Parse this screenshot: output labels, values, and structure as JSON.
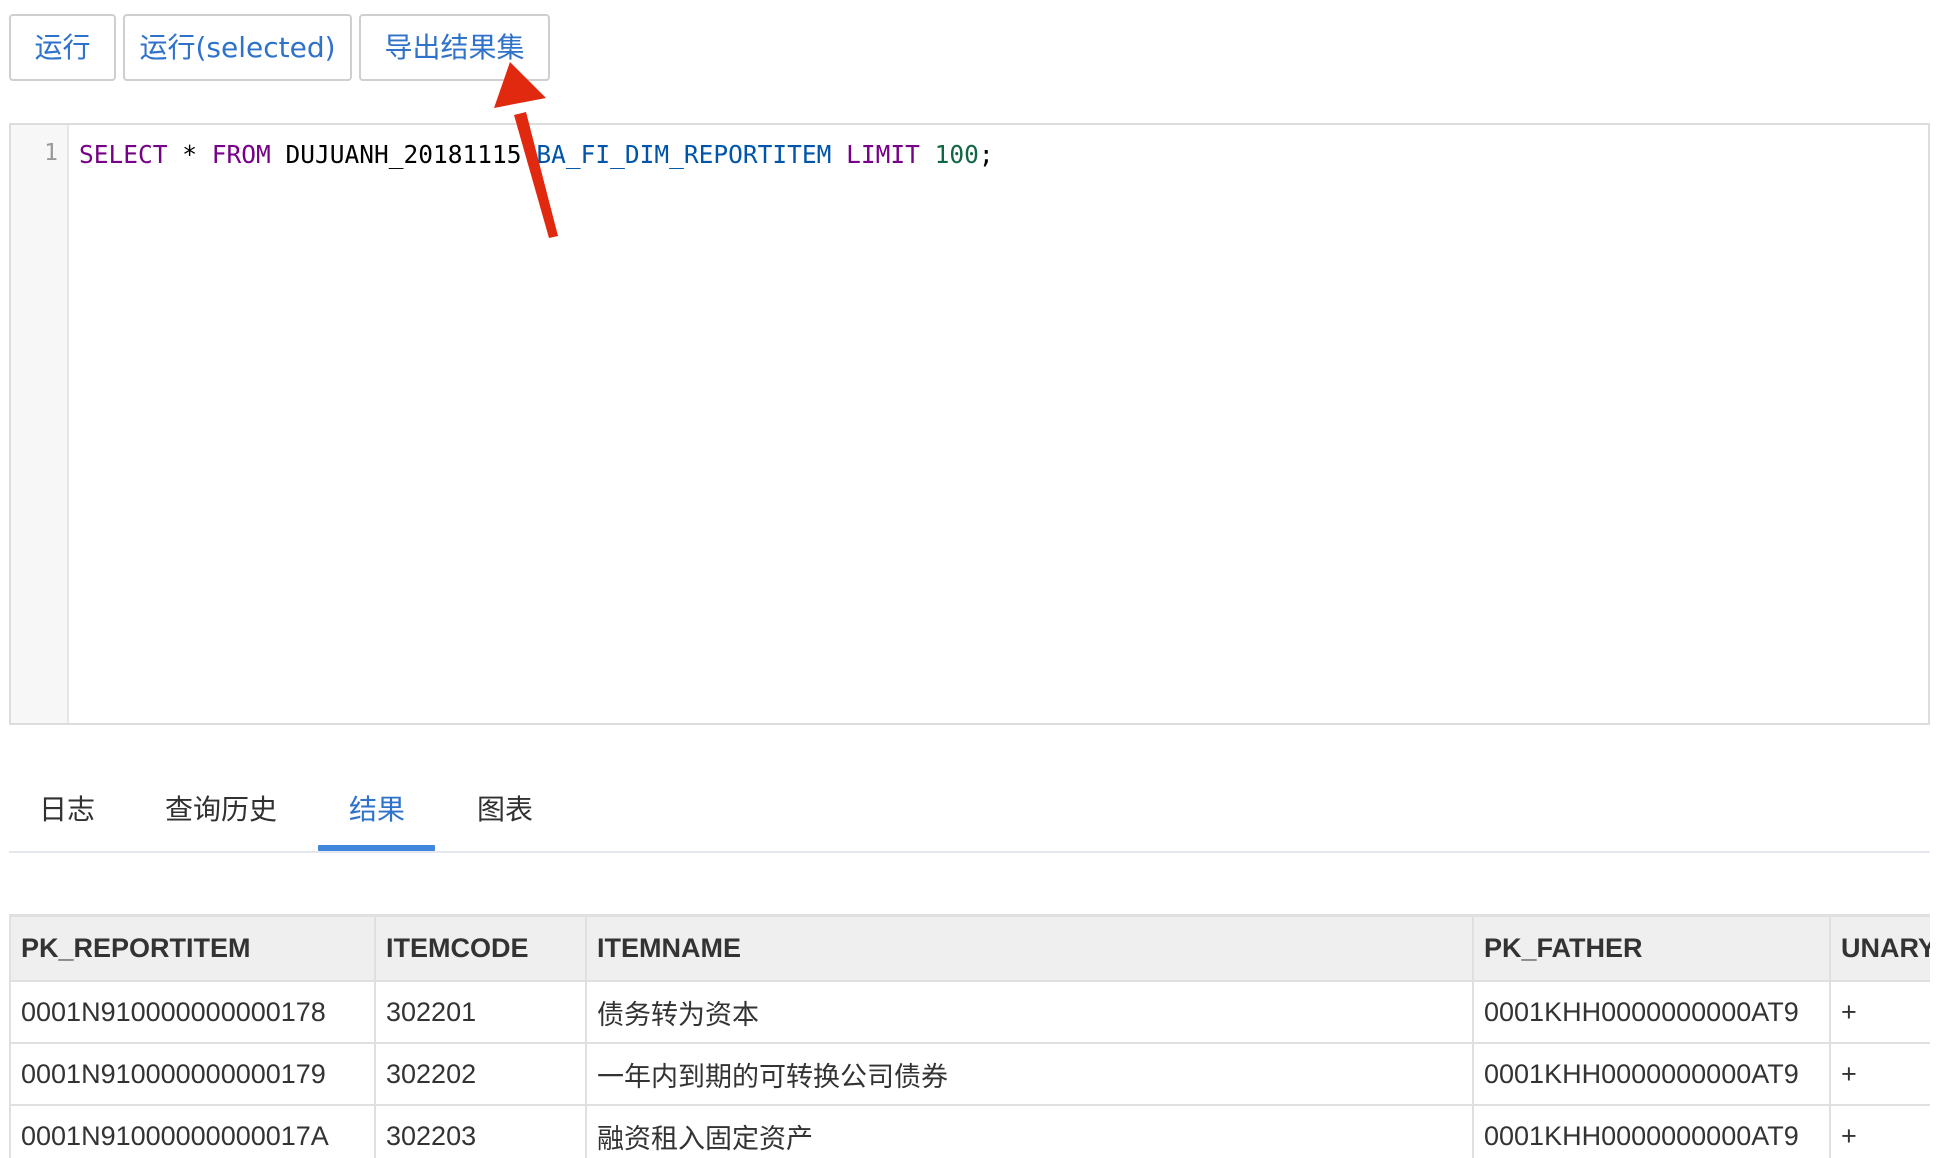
{
  "toolbar": {
    "run_label": "运行",
    "run_selected_label": "运行(selected)",
    "export_label": "导出结果集"
  },
  "editor": {
    "line_number": "1",
    "tokens": {
      "select": "SELECT",
      "star": " * ",
      "from": "FROM",
      "schema": " DUJUANH_20181115",
      "table": ".BA_FI_DIM_REPORTITEM",
      "limit": " LIMIT",
      "count": " 100",
      "semicolon": ";"
    }
  },
  "tabs": [
    {
      "label": "日志"
    },
    {
      "label": "查询历史"
    },
    {
      "label": "结果",
      "active": true
    },
    {
      "label": "图表"
    }
  ],
  "results": {
    "columns": [
      "PK_REPORTITEM",
      "ITEMCODE",
      "ITEMNAME",
      "PK_FATHER",
      "UNARY"
    ],
    "rows": [
      [
        "0001N910000000000178",
        "302201",
        "债务转为资本",
        "0001KHH0000000000AT9",
        "+"
      ],
      [
        "0001N910000000000179",
        "302202",
        "一年内到期的可转换公司债券",
        "0001KHH0000000000AT9",
        "+"
      ],
      [
        "0001N91000000000017A",
        "302203",
        "融资租入固定资产",
        "0001KHH0000000000AT9",
        "+"
      ]
    ]
  },
  "colors": {
    "accent": "#2f72c9",
    "annotation_arrow": "#e0290f",
    "keyword": "#770088",
    "identifier": "#0055aa",
    "number": "#116644"
  }
}
